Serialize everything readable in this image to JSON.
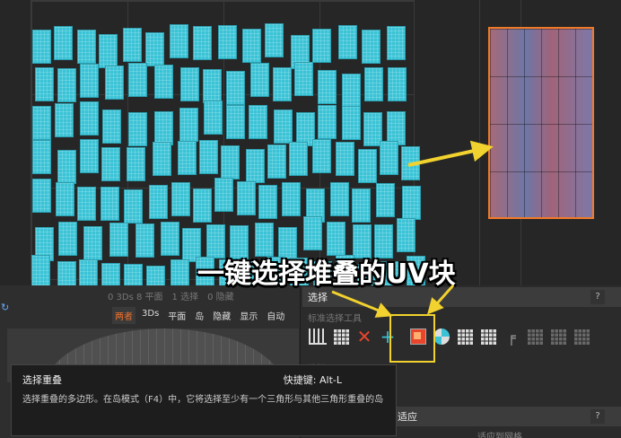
{
  "caption": "一键选择堆叠的UV块",
  "stats": {
    "objects": "0 3Ds 8 平面",
    "selected": "1 选择",
    "hidden": "0 隐藏"
  },
  "view_buttons": [
    {
      "label": "两者",
      "active": true
    },
    {
      "label": "3Ds",
      "active": false
    },
    {
      "label": "平面",
      "active": false
    },
    {
      "label": "岛",
      "active": false
    },
    {
      "label": "隐藏",
      "active": false
    },
    {
      "label": "显示",
      "active": false
    },
    {
      "label": "自动",
      "active": false
    }
  ],
  "select_panel": {
    "title": "选择",
    "help": "?",
    "sub_label": "标准选择工具",
    "row2": "选择"
  },
  "fit_panel": {
    "title": "适应",
    "help": "?",
    "apply": "适应到网格"
  },
  "tooltip": {
    "title": "选择重叠",
    "shortcut": "快捷键: Alt-L",
    "description": "选择重叠的多边形。在岛模式（F4）中，它将选择至少有一个三角形与其他三角形重叠的岛"
  },
  "tools": [
    "bars-icon",
    "grid-icon",
    "deselect-x-icon",
    "add-plus-icon",
    "select-overlap-icon",
    "globe-icon",
    "grid-icon",
    "grid-icon",
    "t-icon",
    "grid-icon",
    "grid-icon",
    "grid-icon"
  ],
  "colors": {
    "island": "#3ac3d6",
    "selection": "#f07a28",
    "highlight": "#f2d22e",
    "accent": "#f0702a"
  }
}
